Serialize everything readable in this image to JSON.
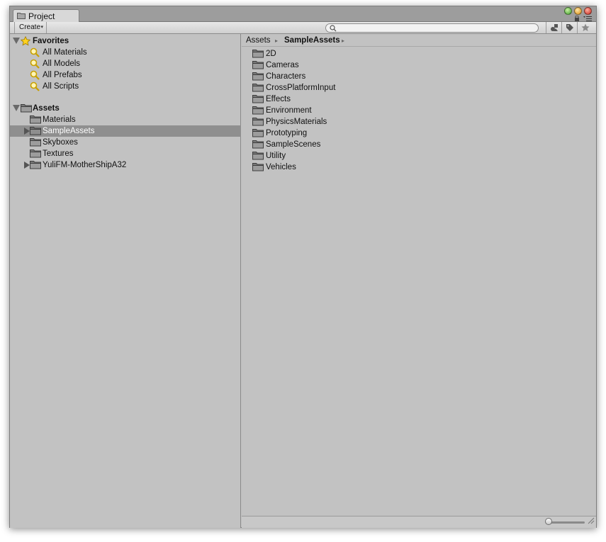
{
  "window": {
    "tab_label": "Project",
    "tab_icon": "folder-icon"
  },
  "toolbar": {
    "create_label": "Create",
    "create_arrow": "▾",
    "search_value": "",
    "buttons": [
      "filter-by-type-icon",
      "filter-by-label-icon",
      "favorites-star-icon"
    ]
  },
  "tree": {
    "favorites": {
      "label": "Favorites",
      "items": [
        "All Materials",
        "All Models",
        "All Prefabs",
        "All Scripts"
      ]
    },
    "assets": {
      "label": "Assets",
      "items": [
        {
          "label": "Materials",
          "expandable": false,
          "selected": false
        },
        {
          "label": "SampleAssets",
          "expandable": true,
          "selected": true
        },
        {
          "label": "Skyboxes",
          "expandable": false,
          "selected": false
        },
        {
          "label": "Textures",
          "expandable": false,
          "selected": false
        },
        {
          "label": "YuliFM-MotherShipA32",
          "expandable": true,
          "selected": false
        }
      ]
    }
  },
  "breadcrumb": {
    "root": "Assets",
    "current": "SampleAssets",
    "separator": "▸"
  },
  "folders": [
    "2D",
    "Cameras",
    "Characters",
    "CrossPlatformInput",
    "Effects",
    "Environment",
    "PhysicsMaterials",
    "Prototyping",
    "SampleScenes",
    "Utility",
    "Vehicles"
  ],
  "colors": {
    "pane_bg": "#c2c2c2",
    "selected_row": "#8f8f8f",
    "selected_text": "#ffffff"
  }
}
